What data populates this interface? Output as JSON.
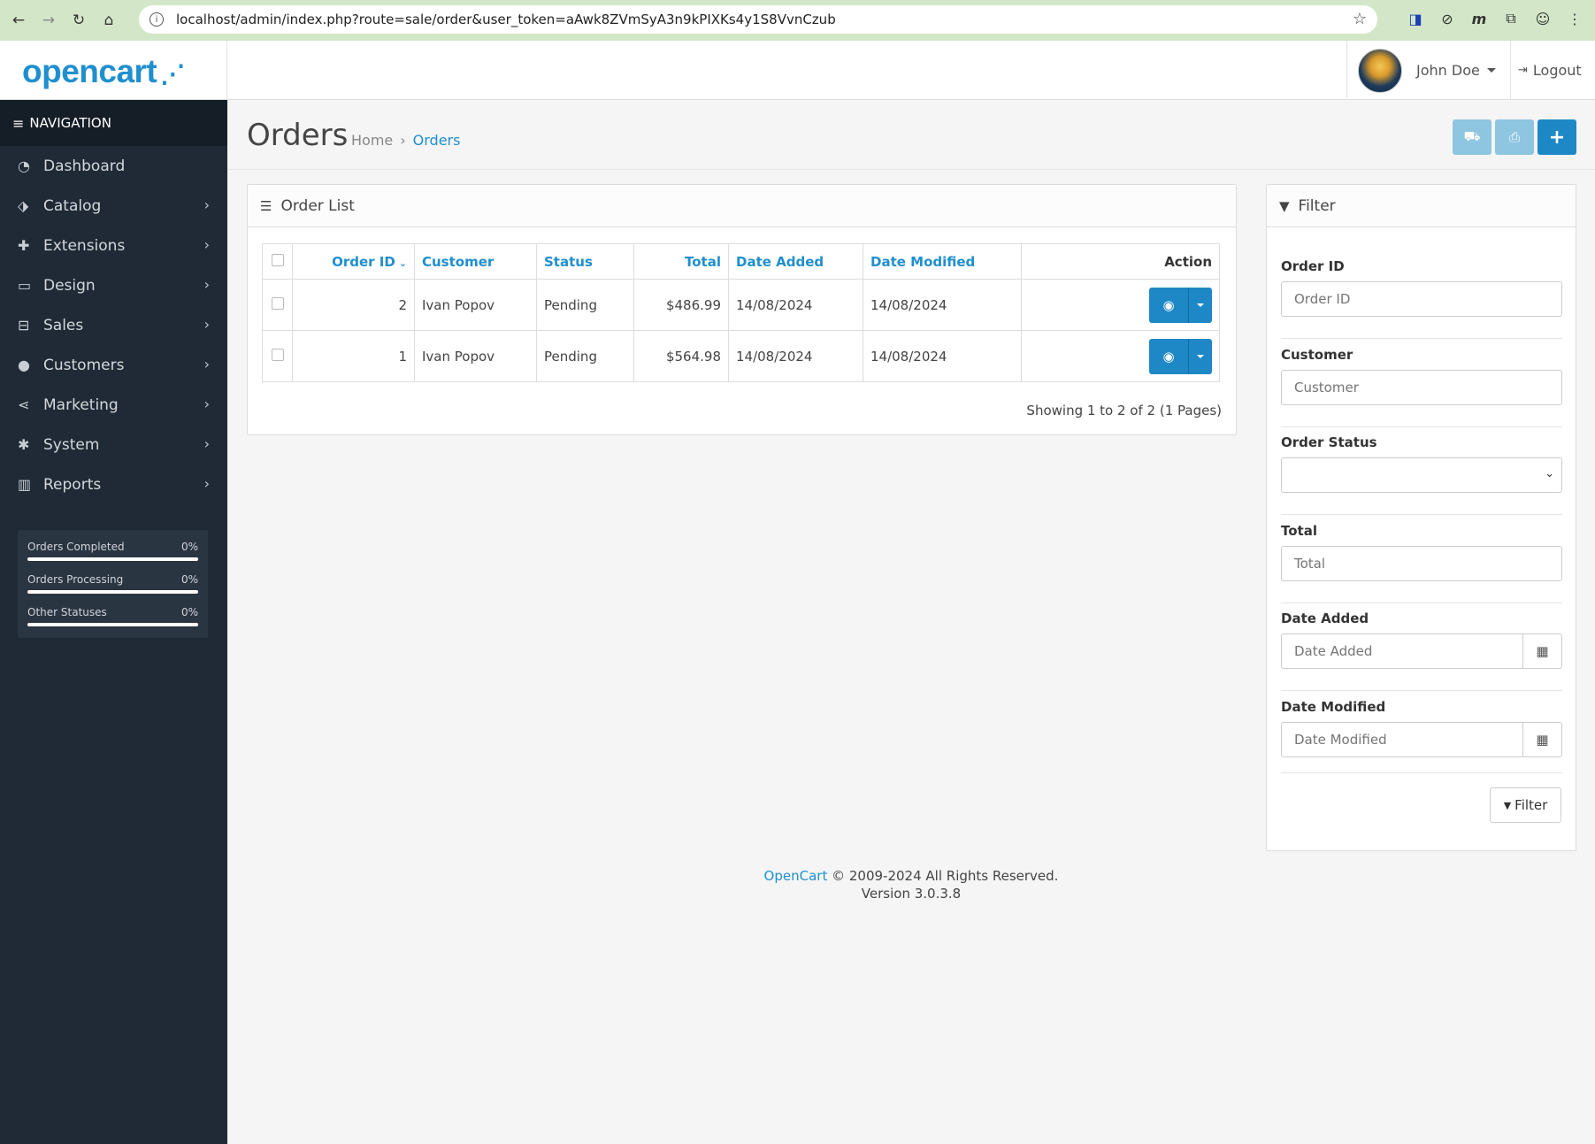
{
  "browser": {
    "url": "localhost/admin/index.php?route=sale/order&user_token=aAwk8ZVmSyA3n9kPIXKs4y1S8VvnCzub"
  },
  "header": {
    "logo": "opencart",
    "user_name": "John Doe",
    "logout_label": "Logout"
  },
  "sidebar": {
    "nav_title": "NAVIGATION",
    "items": [
      {
        "label": "Dashboard",
        "icon": "dashboard-icon"
      },
      {
        "label": "Catalog",
        "icon": "tags-icon"
      },
      {
        "label": "Extensions",
        "icon": "puzzle-icon"
      },
      {
        "label": "Design",
        "icon": "monitor-icon"
      },
      {
        "label": "Sales",
        "icon": "cart-icon"
      },
      {
        "label": "Customers",
        "icon": "user-icon"
      },
      {
        "label": "Marketing",
        "icon": "share-icon"
      },
      {
        "label": "System",
        "icon": "gear-icon"
      },
      {
        "label": "Reports",
        "icon": "bar-chart-icon"
      }
    ],
    "stats": [
      {
        "label": "Orders Completed",
        "value": "0%",
        "fraction": 0
      },
      {
        "label": "Orders Processing",
        "value": "0%",
        "fraction": 0
      },
      {
        "label": "Other Statuses",
        "value": "0%",
        "fraction": 0
      }
    ]
  },
  "page": {
    "title": "Orders",
    "breadcrumb": [
      "Home",
      "Orders"
    ]
  },
  "order_list": {
    "title": "Order List",
    "columns": [
      "Order ID",
      "Customer",
      "Status",
      "Total",
      "Date Added",
      "Date Modified",
      "Action"
    ],
    "rows": [
      {
        "order_id": "2",
        "customer": "Ivan Popov",
        "status": "Pending",
        "total": "$486.99",
        "date_added": "14/08/2024",
        "date_modified": "14/08/2024"
      },
      {
        "order_id": "1",
        "customer": "Ivan Popov",
        "status": "Pending",
        "total": "$564.98",
        "date_added": "14/08/2024",
        "date_modified": "14/08/2024"
      }
    ],
    "showing": "Showing 1 to 2 of 2 (1 Pages)"
  },
  "filter": {
    "title": "Filter",
    "order_id": {
      "label": "Order ID",
      "placeholder": "Order ID"
    },
    "customer": {
      "label": "Customer",
      "placeholder": "Customer"
    },
    "order_status": {
      "label": "Order Status",
      "value": ""
    },
    "total": {
      "label": "Total",
      "placeholder": "Total"
    },
    "date_added": {
      "label": "Date Added",
      "placeholder": "Date Added"
    },
    "date_modified": {
      "label": "Date Modified",
      "placeholder": "Date Modified"
    },
    "button_label": "Filter"
  },
  "footer": {
    "link": "OpenCart",
    "copyright": "© 2009-2024 All Rights Reserved.",
    "version": "Version 3.0.3.8"
  },
  "colors": {
    "brand": "#1f8fcf",
    "sidebar_bg": "#1f2a36",
    "primary_button": "#1e88c7"
  }
}
